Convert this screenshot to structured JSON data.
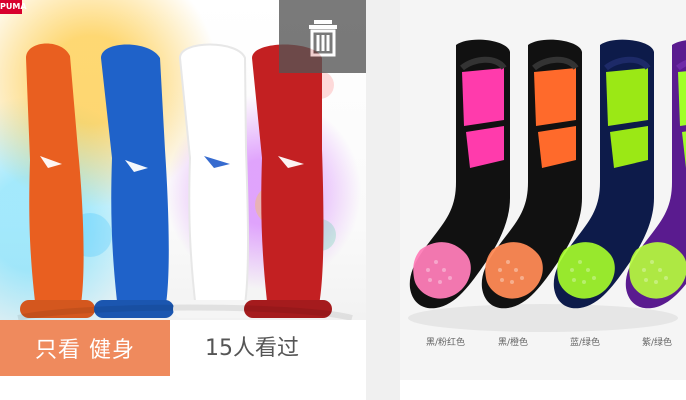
{
  "products": {
    "left": {
      "brand_label": "PUMA",
      "filter_button_label": "只看 健身",
      "view_count_label": "15人看过",
      "delete_icon": "trash-icon",
      "sock_colors": [
        "#e95f20",
        "#1f62c9",
        "#ffffff",
        "#c32022"
      ]
    },
    "right": {
      "color_labels": [
        "黑/粉红色",
        "黑/橙色",
        "蓝/绿色",
        "紫/绿色"
      ],
      "sock_colors": [
        "#ff3bac",
        "#ff6a2b",
        "#9be815",
        "#a0ff28"
      ]
    }
  }
}
